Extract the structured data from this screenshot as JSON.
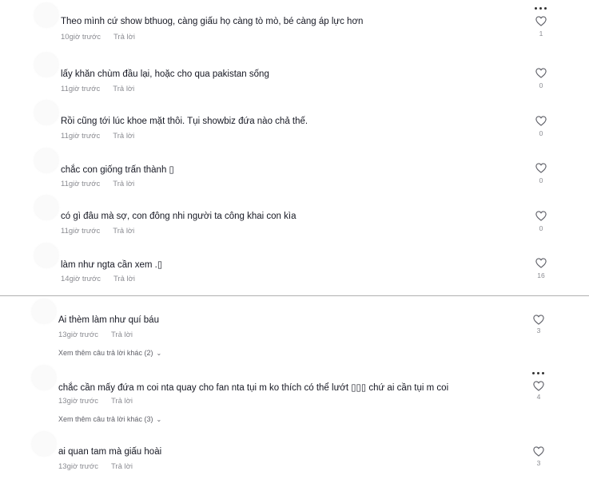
{
  "comments": [
    {
      "text": "Theo mình cứ show bthuog, càng giấu họ càng tò mò, bé càng áp lực hơn",
      "time": "10giờ trước",
      "reply": "Trả lời",
      "likes": "1"
    },
    {
      "text": "lấy khăn chùm đầu lại, hoặc cho qua pakistan sống",
      "time": "11giờ trước",
      "reply": "Trả lời",
      "likes": "0"
    },
    {
      "text": "Rồi cũng tới lúc khoe mặt thôi. Tụi showbiz đứa nào chả thế.",
      "time": "11giờ trước",
      "reply": "Trả lời",
      "likes": "0"
    },
    {
      "text": "chắc con giống trấn thành ▯",
      "time": "11giờ trước",
      "reply": "Trả lời",
      "likes": "0"
    },
    {
      "text": "có gì đâu mà sợ, con đông nhi người ta công khai con kìa",
      "time": "11giờ trước",
      "reply": "Trả lời",
      "likes": "0"
    },
    {
      "text": "làm như ngta cần xem .▯",
      "time": "14giờ trước",
      "reply": "Trả lời",
      "likes": "16"
    },
    {
      "text": "Ai thèm làm như quí báu",
      "time": "13giờ trước",
      "reply": "Trả lời",
      "likes": "3",
      "more": "Xem thêm câu trả lời khác (2)"
    },
    {
      "text": "chắc cần mấy đứa m coi nta quay cho fan nta tụi m ko thích có thể lướt ▯▯▯ chứ ai cần tụi m coi",
      "time": "13giờ trước",
      "reply": "Trả lời",
      "likes": "4",
      "more": "Xem thêm câu trả lời khác (3)"
    },
    {
      "text": "ai quan tam mà giấu hoài",
      "time": "13giờ trước",
      "reply": "Trả lời",
      "likes": "3"
    }
  ],
  "icons": {
    "like": "heart-icon",
    "options": "more-options-icon",
    "expand": "chevron-down-icon"
  },
  "colors": {
    "text": "#161823",
    "meta": "#8a8b91",
    "divider": "#b0b0b0"
  }
}
